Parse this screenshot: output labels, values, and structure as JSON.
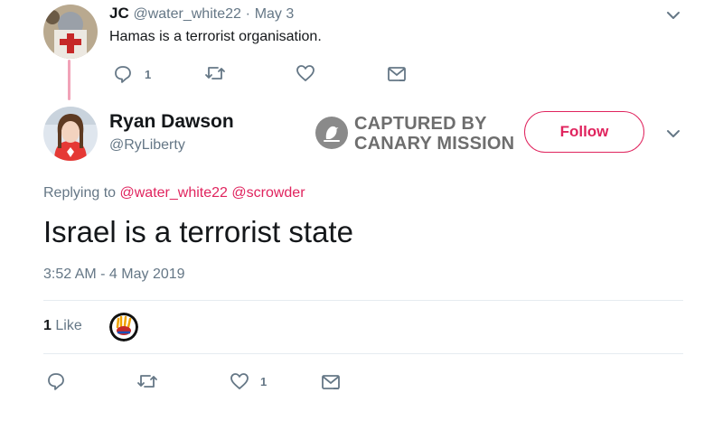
{
  "parent_tweet": {
    "name": "JC",
    "handle": "@water_white22",
    "separator": "·",
    "date": "May 3",
    "text": "Hamas is a terrorist organisation.",
    "reply_count": "1",
    "icons": [
      "reply-icon",
      "retweet-icon",
      "like-icon",
      "message-icon",
      "chevron-down-icon"
    ]
  },
  "main_tweet": {
    "name": "Ryan Dawson",
    "handle": "@RyLiberty",
    "follow_label": "Follow",
    "replying_prefix": "Replying to",
    "mentions": [
      "@water_white22",
      "@scrowder"
    ],
    "text": "Israel is a terrorist state",
    "timestamp": "3:52 AM - 4 May 2019",
    "like_count": "1",
    "like_label": "Like",
    "bottom_like_count": "1",
    "icons": [
      "reply-icon",
      "retweet-icon",
      "like-icon",
      "message-icon",
      "chevron-down-icon"
    ]
  },
  "watermark": {
    "line1": "CAPTURED BY",
    "line2": "CANARY MISSION"
  },
  "colors": {
    "accent": "#e0245e",
    "text": "#14171a",
    "muted": "#657786",
    "divider": "#e6ecf0",
    "thread_line": "#f1a3b8"
  }
}
